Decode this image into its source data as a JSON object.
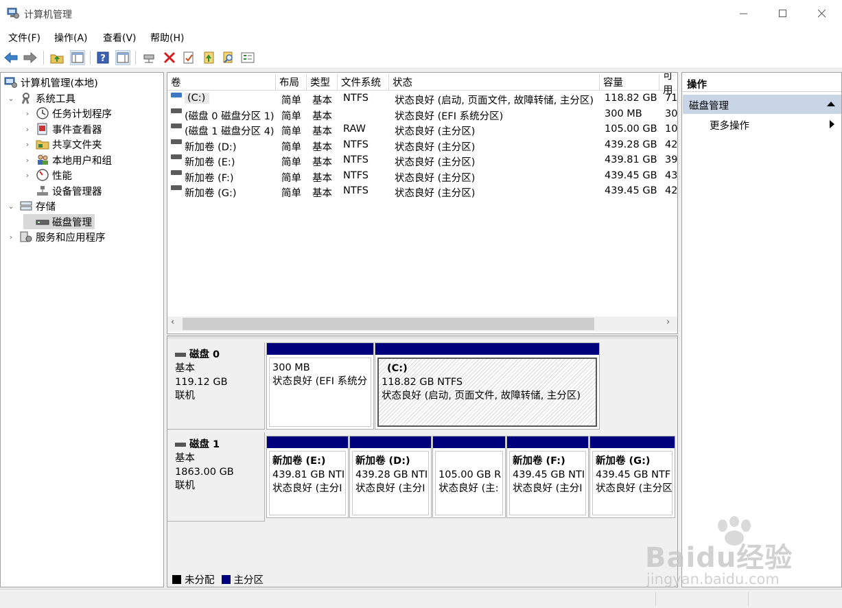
{
  "window": {
    "title": "计算机管理",
    "controls": [
      "minimize-icon",
      "maximize-icon",
      "close-icon"
    ]
  },
  "menu": [
    "文件(F)",
    "操作(A)",
    "查看(V)",
    "帮助(H)"
  ],
  "toolbar": [
    "back-arrow-icon",
    "forward-arrow-icon",
    "up-folder-icon",
    "show-hide-tree-icon",
    "help-icon",
    "show-hide-action-icon",
    "connect-drive-icon",
    "delete-icon",
    "properties-icon",
    "export-icon",
    "search-icon",
    "list-icon"
  ],
  "tree": {
    "root": "计算机管理(本地)",
    "system_tools": "系统工具",
    "task_scheduler": "任务计划程序",
    "event_viewer": "事件查看器",
    "shared_folders": "共享文件夹",
    "local_users": "本地用户和组",
    "performance": "性能",
    "device_manager": "设备管理器",
    "storage": "存储",
    "disk_management": "磁盘管理",
    "services": "服务和应用程序"
  },
  "volumes": {
    "headers": [
      "卷",
      "布局",
      "类型",
      "文件系统",
      "状态",
      "容量",
      "可用"
    ],
    "rows": [
      [
        "(C:)",
        "简单",
        "基本",
        "NTFS",
        "状态良好 (启动, 页面文件, 故障转储, 主分区)",
        "118.82 GB",
        "71"
      ],
      [
        "(磁盘 0 磁盘分区 1)",
        "简单",
        "基本",
        "",
        "状态良好 (EFI 系统分区)",
        "300 MB",
        "30"
      ],
      [
        "(磁盘 1 磁盘分区 4)",
        "简单",
        "基本",
        "RAW",
        "状态良好 (主分区)",
        "105.00 GB",
        "10"
      ],
      [
        "新加卷 (D:)",
        "简单",
        "基本",
        "NTFS",
        "状态良好 (主分区)",
        "439.28 GB",
        "42"
      ],
      [
        "新加卷 (E:)",
        "简单",
        "基本",
        "NTFS",
        "状态良好 (主分区)",
        "439.81 GB",
        "39"
      ],
      [
        "新加卷 (F:)",
        "简单",
        "基本",
        "NTFS",
        "状态良好 (主分区)",
        "439.45 GB",
        "43"
      ],
      [
        "新加卷 (G:)",
        "简单",
        "基本",
        "NTFS",
        "状态良好 (主分区)",
        "439.45 GB",
        "42"
      ]
    ]
  },
  "disks": {
    "disk0": {
      "name": "磁盘 0",
      "type": "基本",
      "size": "119.12 GB",
      "state": "联机",
      "p1": {
        "l1": "300 MB",
        "l2": "状态良好 (EFI 系统分"
      },
      "p2": {
        "name": "(C:)",
        "l1": "118.82 GB NTFS",
        "l2": "状态良好 (启动, 页面文件, 故障转储, 主分区)"
      }
    },
    "disk1": {
      "name": "磁盘 1",
      "type": "基本",
      "size": "1863.00 GB",
      "state": "联机",
      "p1": {
        "name": "新加卷 (E:)",
        "l1": "439.81 GB NTI",
        "l2": "状态良好 (主分I"
      },
      "p2": {
        "name": "新加卷 (D:)",
        "l1": "439.28 GB NTI",
        "l2": "状态良好 (主分I"
      },
      "p3": {
        "l1": "105.00 GB R",
        "l2": "状态良好 (主:"
      },
      "p4": {
        "name": "新加卷 (F:)",
        "l1": "439.45 GB NTI",
        "l2": "状态良好 (主分I"
      },
      "p5": {
        "name": "新加卷 (G:)",
        "l1": "439.45 GB NTF",
        "l2": "状态良好 (主分区"
      }
    }
  },
  "legend": {
    "unallocated": "未分配",
    "primary": "主分区"
  },
  "colors": {
    "unallocated": "#000000",
    "primary": "#00007d",
    "action_section": "#c7d5e6"
  },
  "actions": {
    "header": "操作",
    "section": "磁盘管理",
    "more": "更多操作"
  },
  "watermark": {
    "brand": "Baidu经验",
    "url": "jingyan.baidu.com"
  }
}
